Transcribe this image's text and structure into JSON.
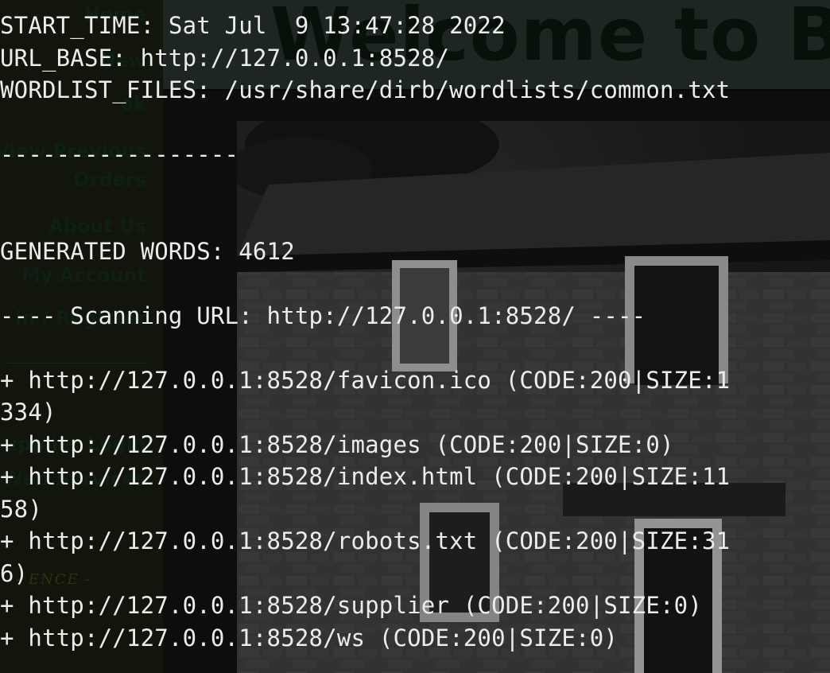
{
  "webpage": {
    "title": "Welcome to BadSt",
    "nav": [
      "Home",
      "New",
      "ok",
      "View Previous",
      "Orders",
      "About Us",
      "My Account",
      "in / Register",
      "upplier Login",
      "Web Services"
    ],
    "credit": "- ENCE -"
  },
  "terminal": {
    "lines": [
      "START_TIME: Sat Jul  9 13:47:28 2022",
      "URL_BASE: http://127.0.0.1:8528/",
      "WORDLIST_FILES: /usr/share/dirb/wordlists/common.txt",
      "",
      "-----------------",
      "",
      "",
      "GENERATED WORDS: 4612",
      "",
      "---- Scanning URL: http://127.0.0.1:8528/ ----",
      "",
      "+ http://127.0.0.1:8528/favicon.ico (CODE:200|SIZE:1",
      "334)",
      "+ http://127.0.0.1:8528/images (CODE:200|SIZE:0)",
      "+ http://127.0.0.1:8528/index.html (CODE:200|SIZE:11",
      "58)",
      "+ http://127.0.0.1:8528/robots.txt (CODE:200|SIZE:31",
      "6)",
      "+ http://127.0.0.1:8528/supplier (CODE:200|SIZE:0)",
      "+ http://127.0.0.1:8528/ws (CODE:200|SIZE:0)"
    ]
  },
  "colors": {
    "terminal_text": "#ececec",
    "sidebar_bg": "#1a2012",
    "header_bg": "#2e3a36",
    "title_color": "#0c1a0e"
  }
}
